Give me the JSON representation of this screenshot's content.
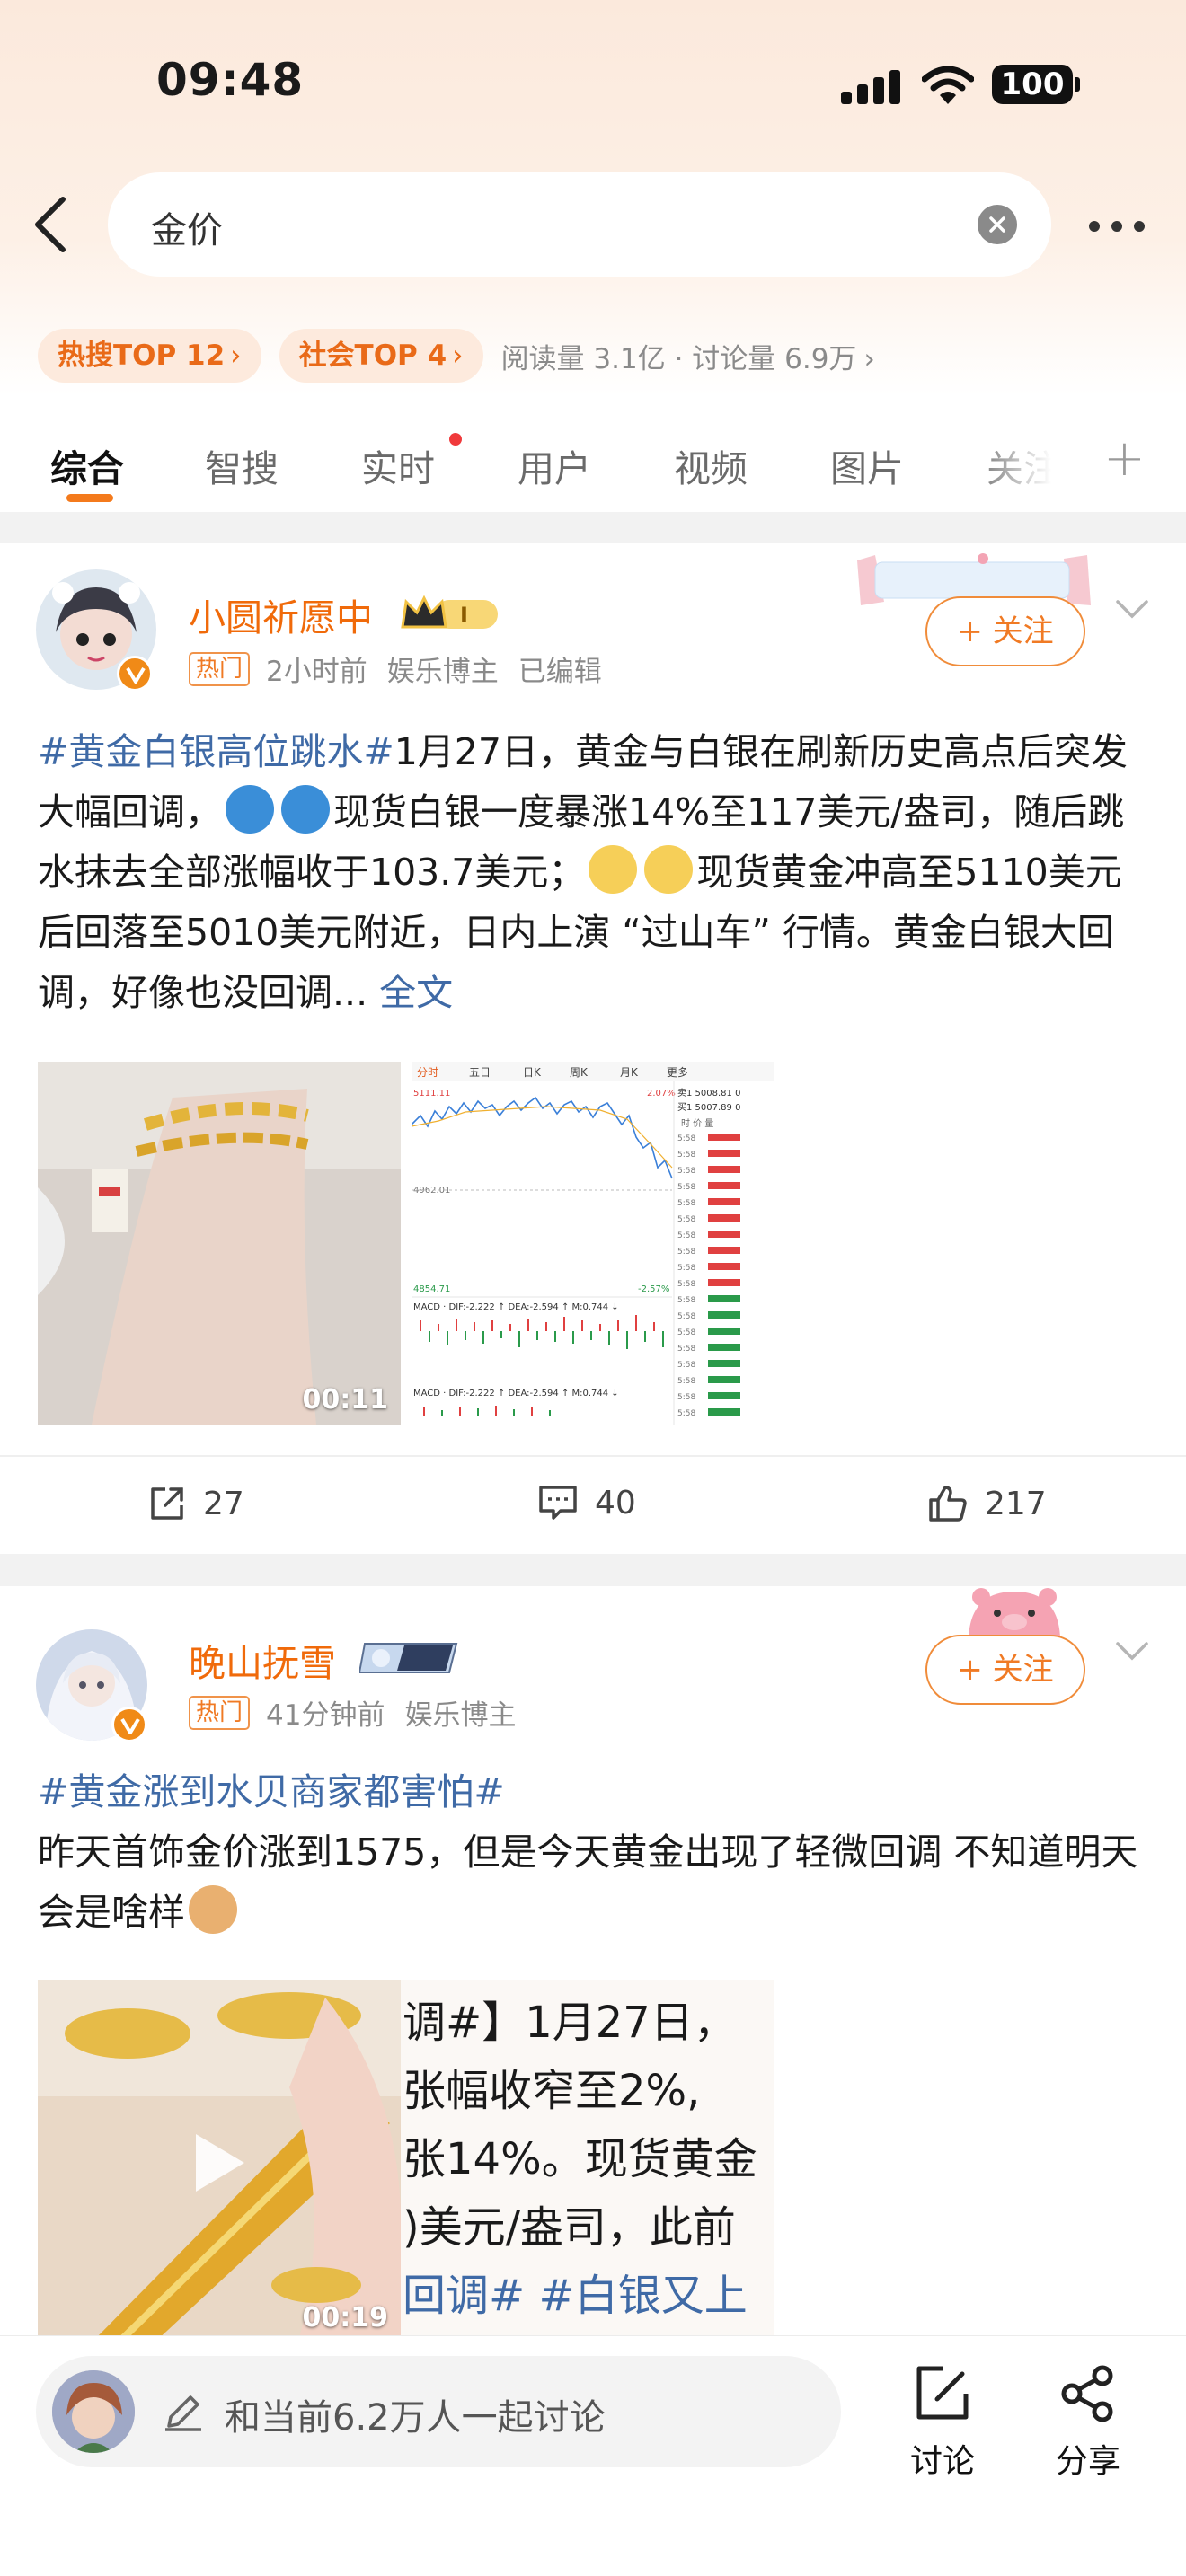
{
  "status_bar": {
    "time": "09:48",
    "battery": "100"
  },
  "search": {
    "query": "金价"
  },
  "hot_tags": [
    {
      "label": "热搜TOP 12"
    },
    {
      "label": "社会TOP 4"
    }
  ],
  "stats": {
    "text": "阅读量 3.1亿 · 讨论量 6.9万"
  },
  "tabs": [
    {
      "label": "综合"
    },
    {
      "label": "智搜"
    },
    {
      "label": "实时"
    },
    {
      "label": "用户"
    },
    {
      "label": "视频"
    },
    {
      "label": "图片"
    },
    {
      "label": "关注"
    }
  ],
  "posts": [
    {
      "username": "小圆祈愿中",
      "hot_label": "热门",
      "time": "2小时前",
      "role": "娱乐博主",
      "edited": "已编辑",
      "follow_label": "+ 关注",
      "topic": "#黄金白银高位跳水#",
      "text_1": "1月27日，黄金与白银在刷新历史高点后突发大幅回调，",
      "text_2": "现货白银一度暴涨14%至117美元/盎司，随后跳水抹去全部涨幅收于103.7美元；",
      "text_3": "现货黄金冲高至5110美元后回落至5010美元附近，日内上演 “过山车” 行情。黄金白银大回调，好像也没回调...",
      "more_label": "全文",
      "video_duration": "00:11",
      "chart_labels": {
        "tabs": [
          "分时",
          "五日",
          "日K",
          "周K",
          "月K",
          "更多"
        ],
        "high": "5111.11",
        "pct_up": "2.07%",
        "mid": "4962.01",
        "low": "4854.71",
        "pct_down": "-2.57%",
        "macd_1": "MACD · DIF:-2.222 ↑ DEA:-2.594 ↑ M:0.744 ↓",
        "macd_2": "MACD · DIF:-2.222 ↑ DEA:-2.594 ↑ M:0.744 ↓",
        "sell1": "卖1  5008.81  0",
        "buy1": "买1  5007.89  0",
        "col_head": "时   价   量",
        "row_time": "5:58"
      },
      "actions": {
        "repost": "27",
        "comment": "40",
        "like": "217"
      }
    },
    {
      "username": "晚山抚雪",
      "hot_label": "热门",
      "time": "41分钟前",
      "role": "娱乐博主",
      "follow_label": "+ 关注",
      "topic": "#黄金涨到水贝商家都害怕#",
      "text_1": "昨天首饰金价涨到1575，但是今天黄金出现了轻微回调 不知道明天会是啥样",
      "video_duration": "00:19",
      "image_text": [
        "调#】1月27日，",
        "张幅收窄至2%,",
        "张14%。现货黄金",
        ")美元/盎司，此前",
        "回调# #白银又上"
      ]
    }
  ],
  "bottom_bar": {
    "placeholder": "和当前6.2万人一起讨论",
    "discuss_label": "讨论",
    "share_label": "分享"
  },
  "colors": {
    "accent_orange": "#f47a1c",
    "link_blue": "#3f6aa6",
    "hot_bg": "#fdeadd",
    "header_bg": "#fbe9dc"
  }
}
